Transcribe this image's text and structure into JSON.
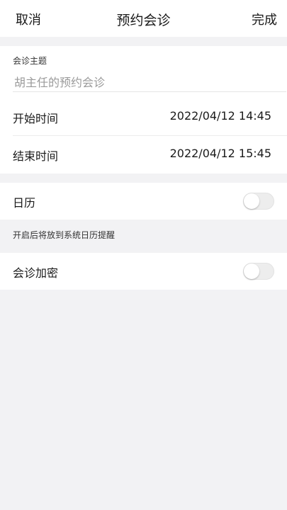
{
  "nav": {
    "cancel_label": "取消",
    "title": "预约会诊",
    "done_label": "完成"
  },
  "form": {
    "topic_label": "会诊主题",
    "topic_placeholder": "胡主任的预约会诊",
    "topic_value": "",
    "start": {
      "label": "开始时间",
      "value": "2022/04/12 14:45"
    },
    "end": {
      "label": "结束时间",
      "value": "2022/04/12 15:45"
    }
  },
  "calendar": {
    "label": "日历",
    "enabled": false,
    "hint": "开启后将放到系统日历提醒"
  },
  "encrypt": {
    "label": "会诊加密",
    "enabled": false
  },
  "colors": {
    "background": "#f2f2f4",
    "card": "#ffffff",
    "toggle_off": "#ededed"
  }
}
